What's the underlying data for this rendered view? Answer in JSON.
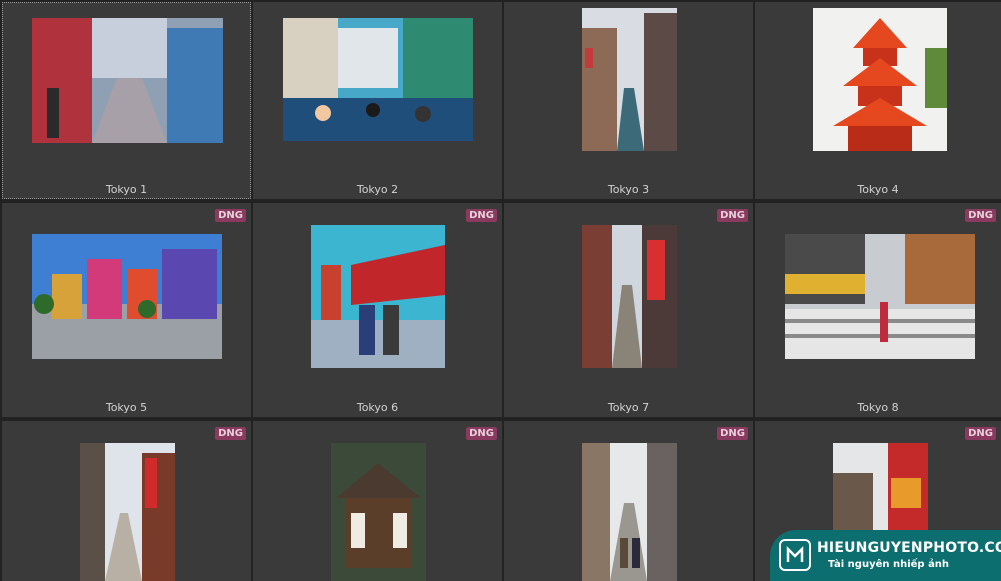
{
  "grid": {
    "items": [
      {
        "label": "Tokyo 1",
        "dng": false,
        "selected": true,
        "badge": ""
      },
      {
        "label": "Tokyo 2",
        "dng": false,
        "selected": false,
        "badge": ""
      },
      {
        "label": "Tokyo 3",
        "dng": false,
        "selected": false,
        "badge": ""
      },
      {
        "label": "Tokyo 4",
        "dng": false,
        "selected": false,
        "badge": ""
      },
      {
        "label": "Tokyo 5",
        "dng": true,
        "selected": false,
        "badge": "DNG"
      },
      {
        "label": "Tokyo 6",
        "dng": true,
        "selected": false,
        "badge": "DNG"
      },
      {
        "label": "Tokyo 7",
        "dng": true,
        "selected": false,
        "badge": "DNG"
      },
      {
        "label": "Tokyo 8",
        "dng": true,
        "selected": false,
        "badge": "DNG"
      },
      {
        "label": "",
        "dng": true,
        "selected": false,
        "badge": "DNG"
      },
      {
        "label": "",
        "dng": true,
        "selected": false,
        "badge": "DNG"
      },
      {
        "label": "",
        "dng": true,
        "selected": false,
        "badge": "DNG"
      },
      {
        "label": "",
        "dng": true,
        "selected": false,
        "badge": "DNG"
      }
    ]
  },
  "watermark": {
    "site": "HIEUNGUYENPHOTO.COM",
    "tagline": "Tài nguyên nhiếp ảnh"
  },
  "colors": {
    "background": "#222222",
    "cell": "#3a3a3a",
    "label": "#d2d2d2",
    "badge": "#8a3a5e",
    "watermark": "#0c6e6f"
  }
}
